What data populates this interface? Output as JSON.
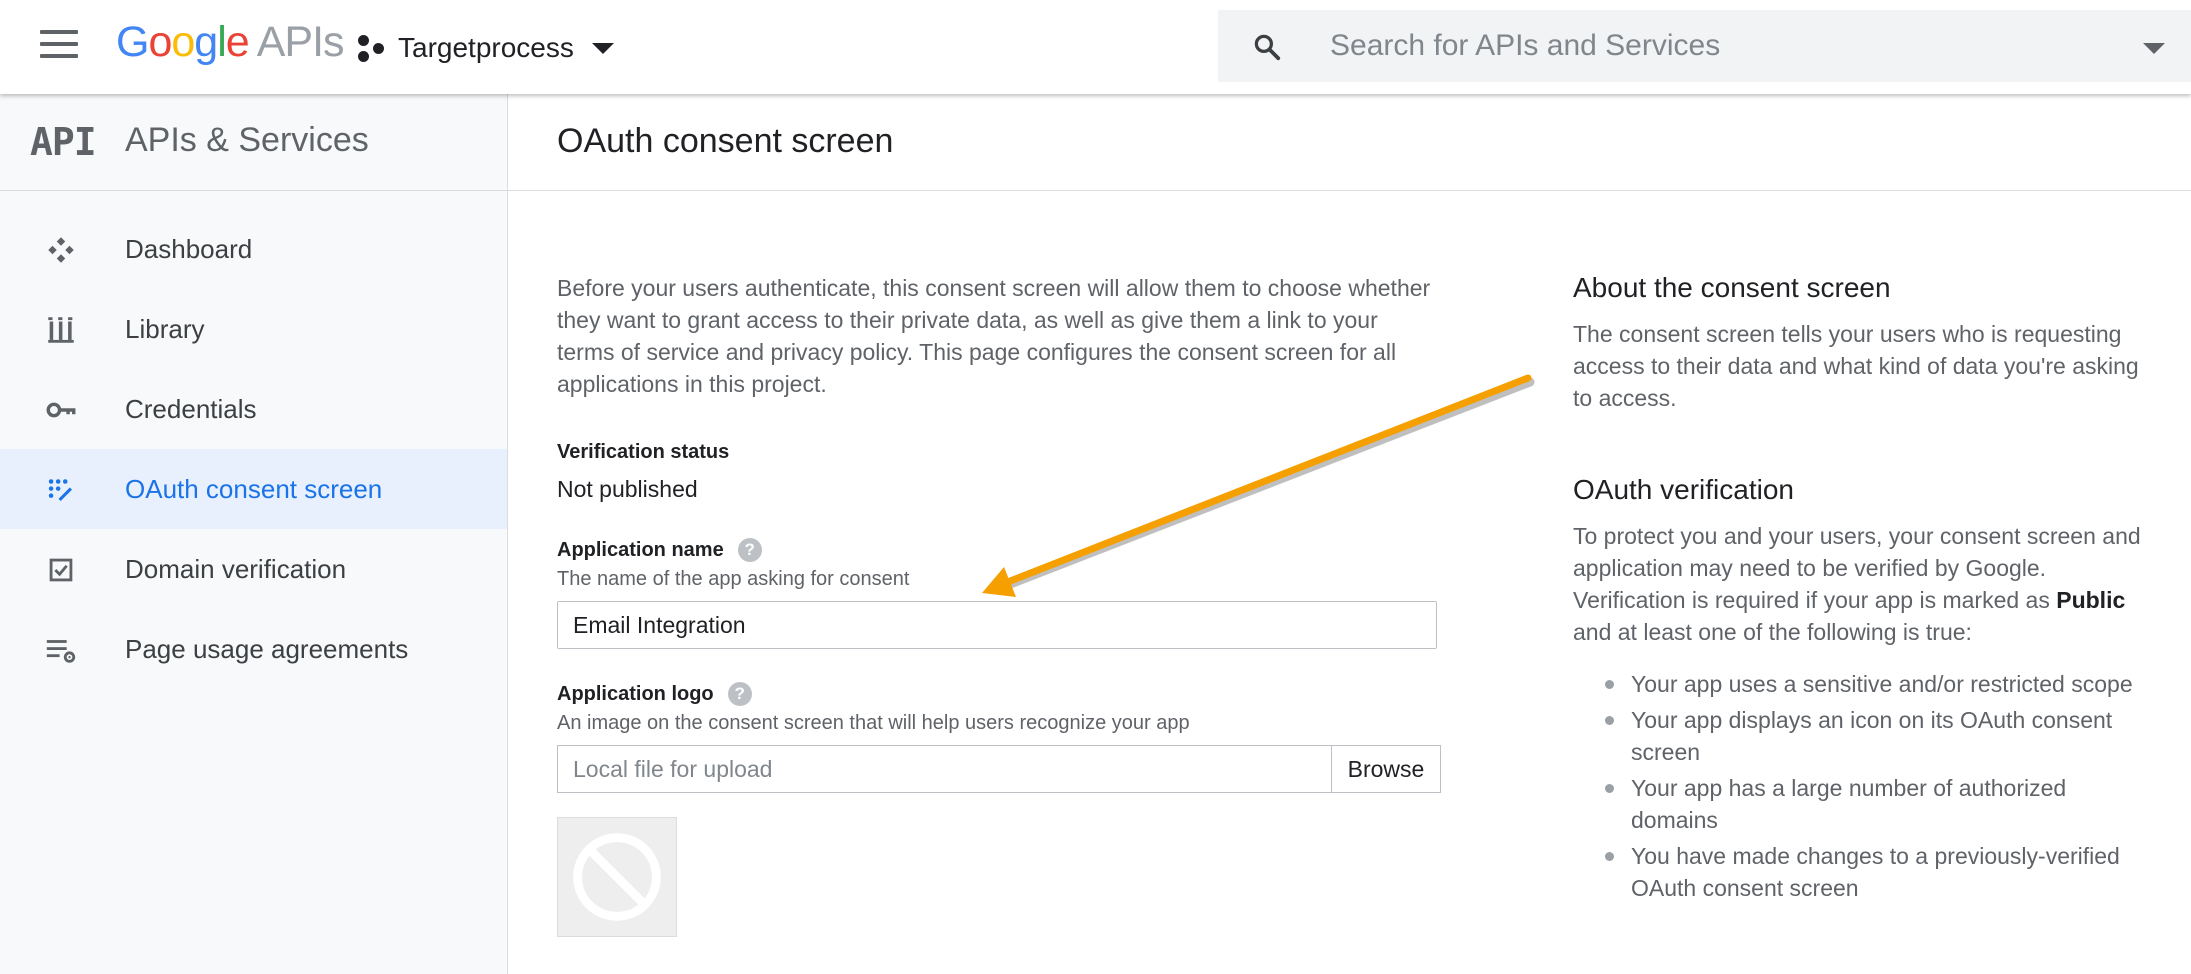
{
  "topbar": {
    "brand_google": [
      "G",
      "o",
      "o",
      "g",
      "l",
      "e"
    ],
    "brand_apis": "APIs",
    "project_name": "Targetprocess",
    "search_placeholder": "Search for APIs and Services"
  },
  "sidebar": {
    "mark": "API",
    "title": "APIs & Services",
    "items": [
      {
        "label": "Dashboard",
        "icon": "dashboard-icon"
      },
      {
        "label": "Library",
        "icon": "library-icon"
      },
      {
        "label": "Credentials",
        "icon": "key-icon"
      },
      {
        "label": "OAuth consent screen",
        "icon": "consent-icon",
        "active": true
      },
      {
        "label": "Domain verification",
        "icon": "checkbox-icon"
      },
      {
        "label": "Page usage agreements",
        "icon": "settings-list-icon"
      }
    ]
  },
  "main": {
    "title": "OAuth consent screen",
    "intro": "Before your users authenticate, this consent screen will allow them to choose whether they want to grant access to their private data, as well as give them a link to your terms of service and privacy policy. This page configures the consent screen for all applications in this project.",
    "verification_status_label": "Verification status",
    "verification_status_value": "Not published",
    "app_name_label": "Application name",
    "app_name_help": "?",
    "app_name_sub": "The name of the app asking for consent",
    "app_name_value": "Email Integration",
    "app_logo_label": "Application logo",
    "app_logo_help": "?",
    "app_logo_sub": "An image on the consent screen that will help users recognize your app",
    "file_placeholder": "Local file for upload",
    "browse_label": "Browse"
  },
  "aside": {
    "about_title": "About the consent screen",
    "about_text": "The consent screen tells your users who is requesting access to their data and what kind of data you're asking to access.",
    "verify_title": "OAuth verification",
    "verify_text_1": "To protect you and your users, your consent screen and application may need to be verified by Google. Verification is required if your app is marked as",
    "verify_text_bold": "Public",
    "verify_text_2": "and at least one of the following is true:",
    "bullets": [
      "Your app uses a sensitive and/or restricted scope",
      "Your app displays an icon on its OAuth consent screen",
      "Your app has a large number of authorized domains",
      "You have made changes to a previously-verified OAuth consent screen"
    ]
  },
  "colors": {
    "accent": "#1a73e8",
    "annotation_arrow": "#f5a000"
  }
}
